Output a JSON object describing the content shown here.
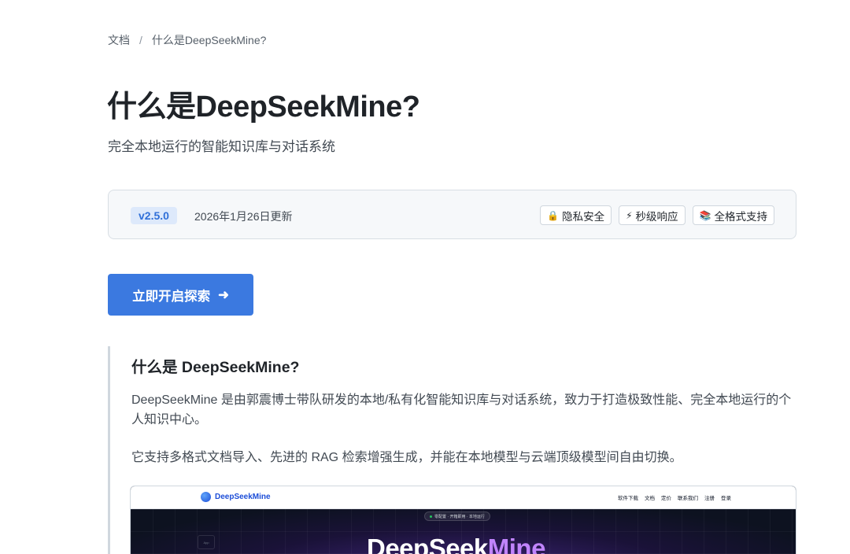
{
  "breadcrumb": {
    "root": "文档",
    "separator": "/",
    "current": "什么是DeepSeekMine?"
  },
  "title": "什么是DeepSeekMine?",
  "subtitle": "完全本地运行的智能知识库与对话系统",
  "meta": {
    "version": "v2.5.0",
    "updated": "2026年1月26日更新",
    "badges": [
      {
        "icon": "lock-icon",
        "glyph": "🔒",
        "label": "隐私安全"
      },
      {
        "icon": "lightning-icon",
        "glyph": "⚡",
        "label": "秒级响应"
      },
      {
        "icon": "books-icon",
        "glyph": "📚",
        "label": "全格式支持"
      }
    ]
  },
  "cta": {
    "label": "立即开启探索",
    "arrow": "➜"
  },
  "section": {
    "title": "什么是 DeepSeekMine?",
    "p1": "DeepSeekMine 是由郭震博士带队研发的本地/私有化智能知识库与对话系统，致力于打造极致性能、完全本地运行的个人知识中心。",
    "p2": "它支持多格式文档导入、先进的 RAG 检索增强生成，并能在本地模型与云端顶级模型间自由切换。"
  },
  "preview": {
    "logo": "DeepSeekMine",
    "menu": [
      "软件下载",
      "文档",
      "定价",
      "联系我们",
      "注册",
      "登录"
    ],
    "pill": "零配置 · 开箱即用 · 本地运行",
    "hero_prefix": "DeepSeek",
    "hero_highlight": "Mine",
    "side_label": "App"
  },
  "colors": {
    "accent": "#3b79e0",
    "version_bg": "#dde9fb",
    "hero_highlight": "#c084fc"
  }
}
